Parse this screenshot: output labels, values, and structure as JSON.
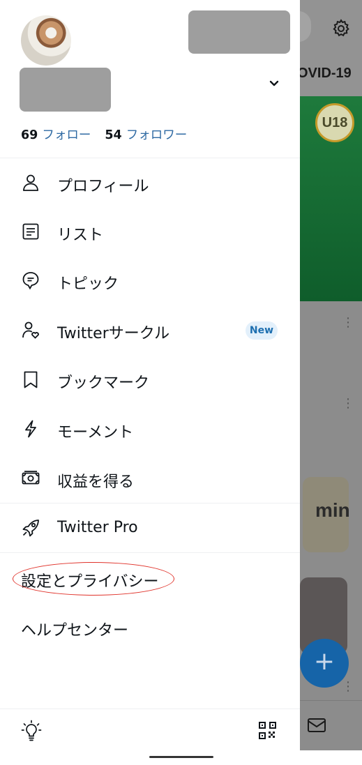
{
  "background": {
    "header_fragment": "OVID-19",
    "badge_text": "U18",
    "card_text": "min",
    "fab_label": "+"
  },
  "profile": {
    "following_count": "69",
    "following_label": "フォロー",
    "followers_count": "54",
    "followers_label": "フォロワー"
  },
  "menu": [
    {
      "label": "プロフィール",
      "icon": "person-icon"
    },
    {
      "label": "リスト",
      "icon": "list-icon"
    },
    {
      "label": "トピック",
      "icon": "topic-icon"
    },
    {
      "label": "Twitterサークル",
      "icon": "circle-people-icon",
      "badge": "New"
    },
    {
      "label": "ブックマーク",
      "icon": "bookmark-icon"
    },
    {
      "label": "モーメント",
      "icon": "lightning-icon"
    },
    {
      "label": "収益を得る",
      "icon": "money-icon"
    },
    {
      "label": "Twitter Pro",
      "icon": "rocket-icon"
    }
  ],
  "settings": {
    "settings_privacy": "設定とプライバシー",
    "help_center": "ヘルプセンター"
  },
  "colors": {
    "link_blue": "#2f6aa3",
    "badge_bg": "#e3f0fb",
    "badge_text": "#1d6fb0",
    "highlight_red": "#e0322a"
  }
}
